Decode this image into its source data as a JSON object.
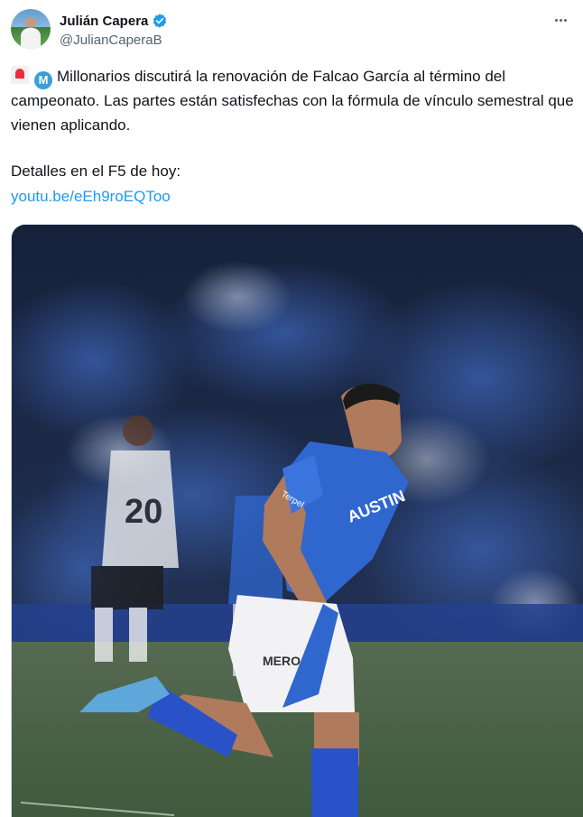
{
  "author": {
    "display_name": "Julián Capera",
    "handle": "@JulianCaperaB",
    "verified_icon": "verified-badge-icon",
    "avatar_icon": "avatar-photo"
  },
  "more_menu_icon": "more-options-icon",
  "tweet": {
    "emoji_1": "siren-emoji-icon",
    "emoji_2": "m-circle-emoji-icon",
    "emoji_m_letter": "M",
    "body": "Millonarios discutirá la renovación de Falcao García al término del campeonato. Las partes están satisfechas con la fórmula de vínculo semestral que vienen aplicando.",
    "details": "Detalles en el F5 de hoy:",
    "link": "youtu.be/eEh9roEQToo"
  },
  "media": {
    "description_icon": "football-photo",
    "jersey_text_1": "AUSTIN",
    "jersey_text_2": "Terpel",
    "opponent_number": "20",
    "shorts_text": "MERO"
  },
  "colors": {
    "link": "#1d9bf0",
    "verified": "#1d9bf0",
    "text": "#0f1419",
    "secondary": "#536471",
    "jersey_blue": "#2f67cf"
  }
}
